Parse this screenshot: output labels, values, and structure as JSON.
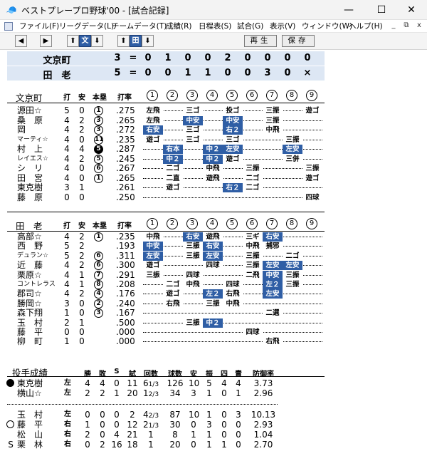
{
  "window": {
    "title": "ベストプレープロ野球'00 - [試合記録]",
    "controls": [
      "—",
      "☐",
      "✕"
    ]
  },
  "menu": {
    "items": [
      "ファイル(F)",
      "リーグデータ(L)",
      "チームデータ(T)",
      "成績(R)",
      "日程表(S)",
      "試合(G)",
      "表示(V)",
      "ウィンドウ(W)",
      "ヘルプ(H)"
    ],
    "mdi_controls": [
      "_",
      "⧉",
      "x"
    ]
  },
  "toolbar": {
    "prev_icon": "left-arrow-icon",
    "next_icon": "right-arrow-icon",
    "up1": "⬆",
    "team1_label": "文",
    "down1": "⬇",
    "up2": "⬆",
    "team2_label": "田",
    "down2": "⬇",
    "play_label": "再生",
    "save_label": "保存"
  },
  "scoreboard": [
    {
      "team": "文京町",
      "total": "3",
      "eq": "=",
      "innings": [
        "0",
        "1",
        "0",
        "0",
        "2",
        "0",
        "0",
        "0",
        "0"
      ]
    },
    {
      "team": "田　老",
      "total": "5",
      "eq": "=",
      "innings": [
        "0",
        "0",
        "1",
        "1",
        "0",
        "0",
        "3",
        "0",
        "×"
      ]
    }
  ],
  "batting_headers": {
    "at_bats": "打",
    "hits": "安",
    "rbi": "本塁",
    "avg": "打率",
    "innings": [
      "1",
      "2",
      "3",
      "4",
      "5",
      "6",
      "7",
      "8",
      "9"
    ]
  },
  "home_team": {
    "name": "文京町",
    "batters": [
      {
        "name": "源田☆",
        "ab": "5",
        "h": "0",
        "hr": "1",
        "hr_filled": false,
        "avg": ".275",
        "results": [
          {
            "i": 1,
            "t": "左飛",
            "hit": false
          },
          {
            "i": 3,
            "t": "三ゴ",
            "hit": false
          },
          {
            "i": 5,
            "t": "投ゴ",
            "hit": false
          },
          {
            "i": 7,
            "t": "三振",
            "hit": false
          },
          {
            "i": 9,
            "t": "遊ゴ",
            "hit": false
          }
        ]
      },
      {
        "name": "桑　原",
        "ab": "4",
        "h": "2",
        "hr": "3",
        "hr_filled": false,
        "avg": ".265",
        "results": [
          {
            "i": 1,
            "t": "左飛",
            "hit": false
          },
          {
            "i": 3,
            "t": "中安",
            "hit": true
          },
          {
            "i": 5,
            "t": "中安",
            "hit": true
          },
          {
            "i": 7,
            "t": "三振",
            "hit": false
          }
        ]
      },
      {
        "name": "岡",
        "ab": "4",
        "h": "2",
        "hr": "3",
        "hr_filled": false,
        "avg": ".272",
        "results": [
          {
            "i": 1,
            "t": "右安",
            "hit": true
          },
          {
            "i": 3,
            "t": "三ゴ",
            "hit": false
          },
          {
            "i": 5,
            "t": "右２",
            "hit": true
          },
          {
            "i": 7,
            "t": "中飛",
            "hit": false
          }
        ]
      },
      {
        "name": "マーティ☆",
        "small": true,
        "ab": "4",
        "h": "0",
        "hr": "11",
        "hr_filled": false,
        "avg": ".235",
        "results": [
          {
            "i": 1,
            "t": "遊ゴ",
            "hit": false
          },
          {
            "i": 3,
            "t": "三ゴ",
            "hit": false
          },
          {
            "i": 5,
            "t": "三ゴ",
            "hit": false
          },
          {
            "i": 8,
            "t": "三振",
            "hit": false
          }
        ]
      },
      {
        "name": "村　上",
        "ab": "4",
        "h": "4",
        "hr": "5",
        "hr_filled": true,
        "avg": ".287",
        "results": [
          {
            "i": 2,
            "t": "右本",
            "hit": true
          },
          {
            "i": 4,
            "t": "中２",
            "hit": true
          },
          {
            "i": 5,
            "t": "左安",
            "hit": true
          },
          {
            "i": 8,
            "t": "左安",
            "hit": true
          }
        ]
      },
      {
        "name": "レイエス☆",
        "small": true,
        "ab": "4",
        "h": "2",
        "hr": "5",
        "hr_filled": false,
        "avg": ".245",
        "results": [
          {
            "i": 2,
            "t": "中２",
            "hit": true
          },
          {
            "i": 4,
            "t": "中２",
            "hit": true
          },
          {
            "i": 5,
            "t": "遊ゴ",
            "hit": false
          },
          {
            "i": 8,
            "t": "三併",
            "hit": false
          }
        ]
      },
      {
        "name": "シ　リ",
        "ab": "4",
        "h": "0",
        "hr": "6",
        "hr_filled": false,
        "avg": ".267",
        "results": [
          {
            "i": 2,
            "t": "二ゴ",
            "hit": false
          },
          {
            "i": 4,
            "t": "中飛",
            "hit": false
          },
          {
            "i": 6,
            "t": "三振",
            "hit": false
          },
          {
            "i": 9,
            "t": "三振",
            "hit": false
          }
        ]
      },
      {
        "name": "田　宮",
        "ab": "4",
        "h": "0",
        "hr": "1",
        "hr_filled": false,
        "avg": ".265",
        "results": [
          {
            "i": 2,
            "t": "二直",
            "hit": false
          },
          {
            "i": 4,
            "t": "遊飛",
            "hit": false
          },
          {
            "i": 6,
            "t": "二ゴ",
            "hit": false
          },
          {
            "i": 9,
            "t": "遊ゴ",
            "hit": false
          }
        ]
      },
      {
        "name": "東克樹",
        "ab": "3",
        "h": "1",
        "hr": "",
        "hr_filled": false,
        "avg": ".261",
        "results": [
          {
            "i": 2,
            "t": "遊ゴ",
            "hit": false
          },
          {
            "i": 5,
            "t": "右２",
            "hit": true
          },
          {
            "i": 6,
            "t": "二ゴ",
            "hit": false
          }
        ]
      },
      {
        "name": "藤　原",
        "ab": "0",
        "h": "0",
        "hr": "",
        "hr_filled": false,
        "avg": ".250",
        "results": [
          {
            "i": 9,
            "t": "四球",
            "hit": false
          }
        ]
      }
    ]
  },
  "away_team": {
    "name": "田　老",
    "batters": [
      {
        "name": "高部☆",
        "ab": "4",
        "h": "2",
        "hr": "1",
        "hr_filled": false,
        "avg": ".235",
        "results": [
          {
            "i": 1,
            "t": "中飛",
            "hit": false
          },
          {
            "i": 3,
            "t": "右安",
            "hit": true
          },
          {
            "i": 4,
            "t": "遊飛",
            "hit": false
          },
          {
            "i": 6,
            "t": "三ギ",
            "hit": false
          },
          {
            "i": 7,
            "t": "右安",
            "hit": true
          }
        ]
      },
      {
        "name": "西　野",
        "ab": "5",
        "h": "2",
        "hr": "",
        "hr_filled": false,
        "avg": ".193",
        "results": [
          {
            "i": 1,
            "t": "中安",
            "hit": true
          },
          {
            "i": 3,
            "t": "三振",
            "hit": false
          },
          {
            "i": 4,
            "t": "右安",
            "hit": true
          },
          {
            "i": 6,
            "t": "中飛",
            "hit": false
          },
          {
            "i": 7,
            "t": "捕邪",
            "hit": false
          }
        ]
      },
      {
        "name": "デュラン☆",
        "small": true,
        "ab": "5",
        "h": "2",
        "hr": "6",
        "hr_filled": false,
        "avg": ".311",
        "results": [
          {
            "i": 1,
            "t": "左安",
            "hit": true
          },
          {
            "i": 3,
            "t": "三振",
            "hit": false
          },
          {
            "i": 4,
            "t": "左安",
            "hit": true
          },
          {
            "i": 6,
            "t": "三振",
            "hit": false
          },
          {
            "i": 8,
            "t": "二ゴ",
            "hit": false
          }
        ]
      },
      {
        "name": "近　藤",
        "ab": "4",
        "h": "2",
        "hr": "6",
        "hr_filled": false,
        "avg": ".300",
        "results": [
          {
            "i": 1,
            "t": "遊ゴ",
            "hit": false
          },
          {
            "i": 4,
            "t": "四球",
            "hit": false
          },
          {
            "i": 6,
            "t": "三振",
            "hit": false
          },
          {
            "i": 7,
            "t": "左安",
            "hit": true
          },
          {
            "i": 8,
            "t": "左安",
            "hit": true
          }
        ]
      },
      {
        "name": "栗原☆",
        "ab": "4",
        "h": "1",
        "hr": "7",
        "hr_filled": false,
        "avg": ".291",
        "results": [
          {
            "i": 1,
            "t": "三振",
            "hit": false
          },
          {
            "i": 3,
            "t": "四球",
            "hit": false
          },
          {
            "i": 6,
            "t": "二飛",
            "hit": false
          },
          {
            "i": 7,
            "t": "中安",
            "hit": true
          },
          {
            "i": 8,
            "t": "三振",
            "hit": false
          }
        ]
      },
      {
        "name": "コントレラス",
        "small": true,
        "ab": "4",
        "h": "1",
        "hr": "8",
        "hr_filled": false,
        "avg": ".208",
        "results": [
          {
            "i": 2,
            "t": "二ゴ",
            "hit": false
          },
          {
            "i": 3,
            "t": "中飛",
            "hit": false
          },
          {
            "i": 5,
            "t": "四球",
            "hit": false
          },
          {
            "i": 7,
            "t": "左２",
            "hit": true
          },
          {
            "i": 8,
            "t": "三振",
            "hit": false
          }
        ]
      },
      {
        "name": "郡司☆",
        "ab": "4",
        "h": "2",
        "hr": "4",
        "hr_filled": false,
        "avg": ".176",
        "results": [
          {
            "i": 2,
            "t": "遊ゴ",
            "hit": false
          },
          {
            "i": 4,
            "t": "左２",
            "hit": true
          },
          {
            "i": 5,
            "t": "右飛",
            "hit": false
          },
          {
            "i": 7,
            "t": "左安",
            "hit": true
          }
        ]
      },
      {
        "name": "勝岡☆",
        "ab": "3",
        "h": "0",
        "hr": "2",
        "hr_filled": false,
        "avg": ".240",
        "results": [
          {
            "i": 2,
            "t": "右飛",
            "hit": false
          },
          {
            "i": 4,
            "t": "三振",
            "hit": false
          },
          {
            "i": 5,
            "t": "中飛",
            "hit": false
          }
        ]
      },
      {
        "name": "森下翔",
        "ab": "1",
        "h": "0",
        "hr": "3",
        "hr_filled": false,
        "avg": ".167",
        "results": [
          {
            "i": 7,
            "t": "二選",
            "hit": false
          }
        ]
      },
      {
        "name": "玉　村",
        "ab": "2",
        "h": "1",
        "hr": "",
        "hr_filled": false,
        "avg": ".500",
        "results": [
          {
            "i": 3,
            "t": "三振",
            "hit": false
          },
          {
            "i": 4,
            "t": "中２",
            "hit": true
          }
        ]
      },
      {
        "name": "藤　平",
        "ab": "0",
        "h": "0",
        "hr": "",
        "hr_filled": false,
        "avg": ".000",
        "results": [
          {
            "i": 6,
            "t": "四球",
            "hit": false
          }
        ]
      },
      {
        "name": "柳　町",
        "ab": "1",
        "h": "0",
        "hr": "",
        "hr_filled": false,
        "avg": ".000",
        "results": [
          {
            "i": 7,
            "t": "右飛",
            "hit": false
          }
        ]
      }
    ]
  },
  "pitching": {
    "title": "投手成績",
    "headers": [
      "勝",
      "敗",
      "S",
      "試",
      "回数",
      "球数",
      "安",
      "振",
      "四",
      "責",
      "防御率"
    ],
    "home": [
      {
        "marker": "filled",
        "name": "東克樹",
        "hand": "左",
        "w": "4",
        "l": "4",
        "s": "0",
        "g": "11",
        "ip": "6",
        "ipf": "1/3",
        "pitches": "126",
        "h": "10",
        "so": "5",
        "bb": "4",
        "er": "4",
        "era": "3.73"
      },
      {
        "marker": "",
        "name": "横山☆",
        "hand": "左",
        "w": "2",
        "l": "2",
        "s": "1",
        "g": "20",
        "ip": "1",
        "ipf": "2/3",
        "pitches": "34",
        "h": "3",
        "so": "1",
        "bb": "0",
        "er": "1",
        "era": "2.96"
      }
    ],
    "away": [
      {
        "marker": "",
        "name": "玉　村",
        "hand": "左",
        "w": "0",
        "l": "0",
        "s": "0",
        "g": "2",
        "ip": "4",
        "ipf": "2/3",
        "pitches": "87",
        "h": "10",
        "so": "1",
        "bb": "0",
        "er": "3",
        "era": "10.13"
      },
      {
        "marker": "open",
        "name": "藤　平",
        "hand": "右",
        "w": "1",
        "l": "0",
        "s": "0",
        "g": "12",
        "ip": "2",
        "ipf": "1/3",
        "pitches": "30",
        "h": "0",
        "so": "3",
        "bb": "0",
        "er": "0",
        "era": "2.93"
      },
      {
        "marker": "",
        "name": "松　山",
        "hand": "右",
        "w": "2",
        "l": "0",
        "s": "4",
        "g": "21",
        "ip": "1",
        "ipf": "",
        "pitches": "8",
        "h": "1",
        "so": "1",
        "bb": "0",
        "er": "0",
        "era": "1.04"
      },
      {
        "marker": "S",
        "name": "栗　林",
        "hand": "右",
        "w": "0",
        "l": "2",
        "s": "16",
        "g": "18",
        "ip": "1",
        "ipf": "",
        "pitches": "20",
        "h": "0",
        "so": "1",
        "bb": "1",
        "er": "0",
        "era": "2.70"
      }
    ]
  }
}
